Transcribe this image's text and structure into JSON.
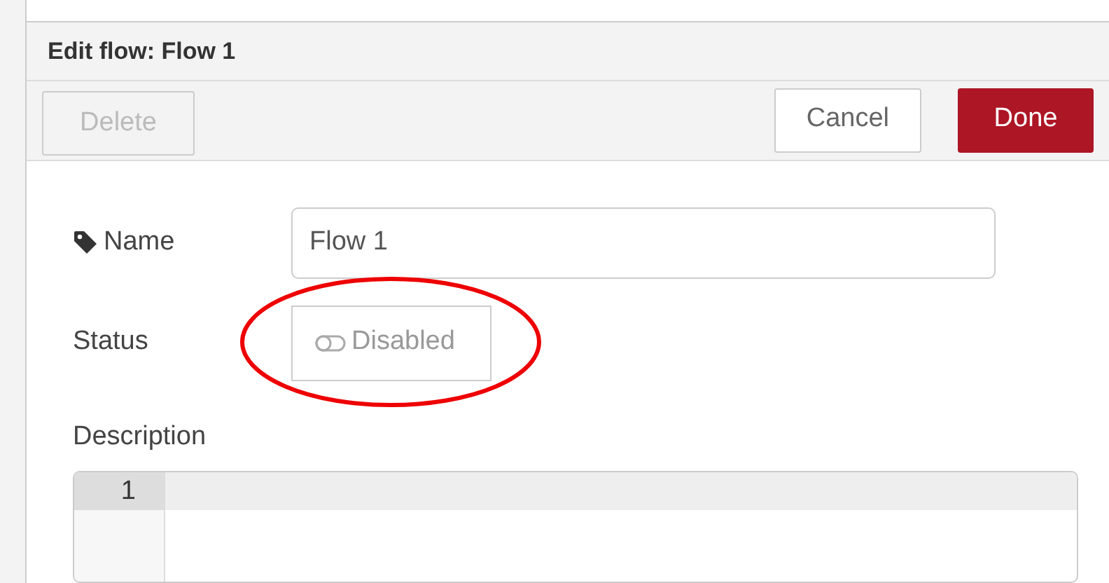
{
  "dialog": {
    "title": "Edit flow: Flow 1"
  },
  "buttons": [
    {
      "label": "Delete",
      "kind": "plain",
      "disabled": true
    },
    {
      "label": "Cancel",
      "kind": "plain",
      "disabled": false
    },
    {
      "label": "Done",
      "kind": "primary",
      "disabled": false
    }
  ],
  "name_field": {
    "label": "Name",
    "value": "Flow 1"
  },
  "status_field": {
    "label": "Status",
    "toggle_label": "Disabled",
    "on": false
  },
  "description": {
    "label": "Description",
    "line_numbers": [
      "1"
    ]
  }
}
